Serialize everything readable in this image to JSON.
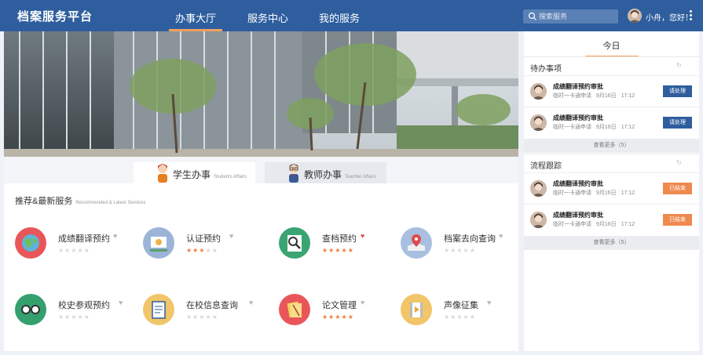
{
  "header": {
    "logo": "档案服务平台",
    "nav": [
      "办事大厅",
      "服务中心",
      "我的服务"
    ],
    "search_placeholder": "搜索服务",
    "greeting": "小舟，您好！"
  },
  "tabs": [
    {
      "label": "学生办事",
      "sub": "Students Affairs"
    },
    {
      "label": "教师办事",
      "sub": "Teacher Affairs"
    }
  ],
  "section": {
    "title": "推荐&最新服务",
    "sub": "Recommended & Latest Services"
  },
  "services": [
    {
      "name": "成绩翻译预约",
      "stars": 0,
      "fav": false,
      "icon": "globe-icon",
      "color": "#e9565a"
    },
    {
      "name": "认证预约",
      "stars": 3,
      "fav": false,
      "icon": "certificate-icon",
      "color": "#9bb4d8"
    },
    {
      "name": "查档预约",
      "stars": 5,
      "fav": true,
      "icon": "magnifier-icon",
      "color": "#3aa473"
    },
    {
      "name": "档案去向查询",
      "stars": 0,
      "fav": false,
      "icon": "map-pin-icon",
      "color": "#a9bfdf"
    },
    {
      "name": "校史参观预约",
      "stars": 0,
      "fav": false,
      "icon": "glasses-icon",
      "color": "#34a06e"
    },
    {
      "name": "在校信息查询",
      "stars": 0,
      "fav": false,
      "icon": "clipboard-icon",
      "color": "#f1c56a"
    },
    {
      "name": "论文管理",
      "stars": 5,
      "fav": false,
      "icon": "paper-icon",
      "color": "#e9565a"
    },
    {
      "name": "声像征集",
      "stars": 0,
      "fav": false,
      "icon": "film-icon",
      "color": "#f1c56a"
    }
  ],
  "sidebar": {
    "today": "今日",
    "pending": {
      "title": "待办事项",
      "items": [
        {
          "title": "成绩翻译预约审批",
          "applicant": "临时一卡通申请",
          "date": "9月16日",
          "time": "17:12",
          "action": "请处理"
        },
        {
          "title": "成绩翻译预约审批",
          "applicant": "临时一卡通申请",
          "date": "9月16日",
          "time": "17:12",
          "action": "请处理"
        }
      ],
      "more": "查看更多（5）"
    },
    "tracking": {
      "title": "流程跟踪",
      "items": [
        {
          "title": "成绩翻译预约审批",
          "applicant": "临时一卡通申请",
          "date": "9月16日",
          "time": "17:12",
          "action": "已结束"
        },
        {
          "title": "成绩翻译预约审批",
          "applicant": "临时一卡通申请",
          "date": "9月16日",
          "time": "17:12",
          "action": "已结束"
        }
      ],
      "more": "查看更多（5）"
    }
  },
  "colors": {
    "primary": "#2e5e9e",
    "accent": "#ef8a4f",
    "star": "#ef7d3b"
  }
}
